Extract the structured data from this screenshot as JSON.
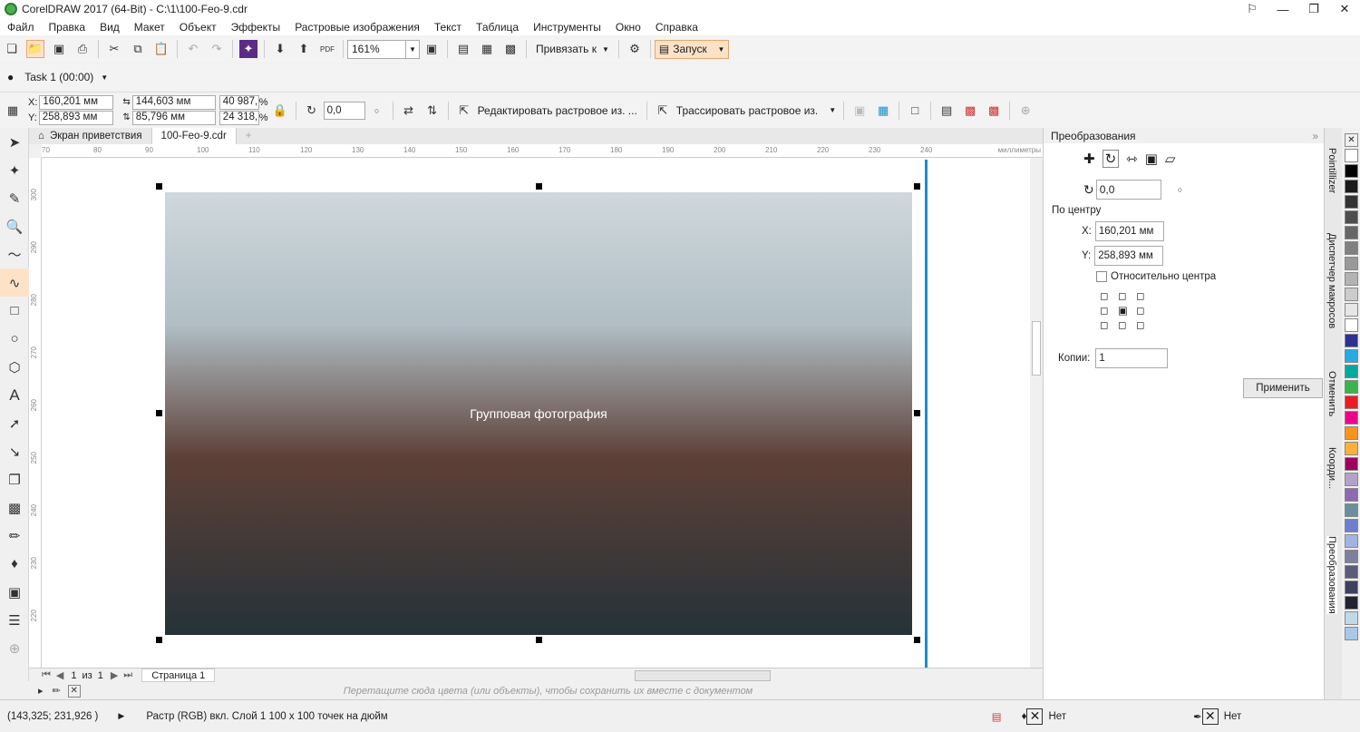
{
  "title": "CorelDRAW 2017 (64-Bit) - C:\\1\\100-Feo-9.cdr",
  "menu": [
    "Файл",
    "Правка",
    "Вид",
    "Макет",
    "Объект",
    "Эффекты",
    "Растровые изображения",
    "Текст",
    "Таблица",
    "Инструменты",
    "Окно",
    "Справка"
  ],
  "toolbar": {
    "zoom": "161%",
    "snap": "Привязать к",
    "launch": "Запуск"
  },
  "task": "Task 1 (00:00)",
  "props": {
    "x": "160,201 мм",
    "y": "258,893 мм",
    "w": "144,603 мм",
    "h": "85,796 мм",
    "sx": "40 987,",
    "sy": "24 318,",
    "pct": "%",
    "angle": "0,0",
    "edit": "Редактировать растровое из. ...",
    "trace": "Трассировать растровое из."
  },
  "tabs": {
    "welcome": "Экран приветствия",
    "doc": "100-Feo-9.cdr"
  },
  "ruler": {
    "ticks": [
      "70",
      "80",
      "90",
      "100",
      "110",
      "120",
      "130",
      "140",
      "150",
      "160",
      "170",
      "180",
      "190",
      "200",
      "210",
      "220",
      "230",
      "240"
    ],
    "unit": "миллиметры",
    "vticks": [
      "300",
      "290",
      "280",
      "270",
      "260",
      "250",
      "240",
      "230",
      "220"
    ]
  },
  "photo_alt": "Групповая фотография",
  "pagebar": {
    "page": "1",
    "of": "из",
    "total": "1",
    "pagetab": "Страница 1"
  },
  "palhint": "Перетащите сюда цвета (или объекты), чтобы сохранить их вместе с документом",
  "docker": {
    "title": "Преобразования",
    "angle": "0,0",
    "center": "По центру",
    "x": "160,201 мм",
    "y": "258,893 мм",
    "relative": "Относительно центра",
    "copies_label": "Копии:",
    "copies": "1",
    "apply": "Применить",
    "xl": "X:",
    "yl": "Y:"
  },
  "sidetabs": [
    "Pointillizer",
    "Диспетчер макросов",
    "Отменить",
    "Коорди...",
    "Преобразования"
  ],
  "palette": [
    "#ffffff",
    "#000000",
    "#1a1a1a",
    "#333333",
    "#4d4d4d",
    "#666666",
    "#808080",
    "#999999",
    "#b3b3b3",
    "#cccccc",
    "#e6e6e6",
    "#ffffff",
    "#2e3192",
    "#29abe2",
    "#00a99d",
    "#39b54a",
    "#ed1c24",
    "#ec008c",
    "#f7941d",
    "#fbb03b",
    "#9e005d",
    "#b3a2c7",
    "#8c6bb1",
    "#6b8e9e",
    "#6d7fcc",
    "#a0b4e0",
    "#7f7f9f",
    "#5b5b7a",
    "#3f3f5f",
    "#222233",
    "#c0d8e8",
    "#a8c8e8"
  ],
  "status": {
    "coords": "(143,325; 231,926 )",
    "info": "Растр (RGB) вкл. Слой 1 100 х 100 точек на дюйм",
    "fill": "Нет",
    "outline": "Нет"
  }
}
